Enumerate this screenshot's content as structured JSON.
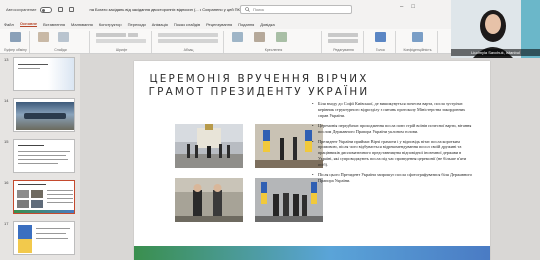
{
  "titlebar": {
    "autosave_label": "Автосохранение",
    "doc_title": "на Богато засідань від засідання двосторонніх відносин (...   •   Сохранено у цей ПК",
    "search_placeholder": "Поиск"
  },
  "ribbon": {
    "tabs": [
      "Файл",
      "Основне",
      "Вставлення",
      "Малювання",
      "Конструктор",
      "Переходи",
      "Анімація",
      "Показ слайдів",
      "Рецензування",
      "Подання",
      "Довідка"
    ],
    "active_tab": "Основне",
    "groups": [
      "Буфер обміну",
      "Слайди",
      "Шрифт",
      "Абзац",
      "Креслення",
      "Редагування",
      "Голос",
      "Конфіденційність"
    ],
    "paste_label": "Вставити",
    "new_slide_label": "Створити слайд",
    "reuse_label": "Повторно використати слайди",
    "shapes_label": "Фігури",
    "arrange_label": "Упорядкувати",
    "styles_label": "Стилі",
    "dictate_label": "Диктування",
    "sensitivity_label": "Конфіденційність"
  },
  "slides_pane": {
    "items": [
      {
        "number": "13"
      },
      {
        "number": "14"
      },
      {
        "number": "15"
      },
      {
        "number": "16"
      },
      {
        "number": "17"
      }
    ],
    "active_number": "16"
  },
  "slide": {
    "title_line1": "ЦЕРЕМОНІЯ ВРУЧЕННЯ ВІРЧИХ",
    "title_line2": "ГРАМОТ ПРЕЗИДЕНТУ УКРАЇНИ",
    "bullets": [
      "Біля входу до Софії Київської, де вишикувуться почесна варта, посла зустрічає керівник структурного відрозділу з питань протоколу Міністерства закордонних справ України.",
      "Церемонія передбачає проходження посла повз стрій воїнів почесної варти, вітання послом Державного Прапора України уклоном голови.",
      "Президент України приймає Вірчі грамоти і у відповідь вітає посла коротким промовою, після чого відбувається відрекомендування посол своїй дружині та працівників дипломатичного представництва відповідної іноземної держави в Україні, які супроводжують посла під час проведення церемонії (не більше п'яти осіб).",
      "Після цього Президент України запрошує посла сфотографуватися біля Державного Прапора України."
    ]
  },
  "video": {
    "name": "Liudmyla Savchuk, Istanbul"
  },
  "colors": {
    "accent": "#b7472a",
    "active_slide_border": "#c44a2e",
    "slide_bottom_green": "#3a8f4e",
    "slide_bottom_blue": "#4a7bc4"
  }
}
